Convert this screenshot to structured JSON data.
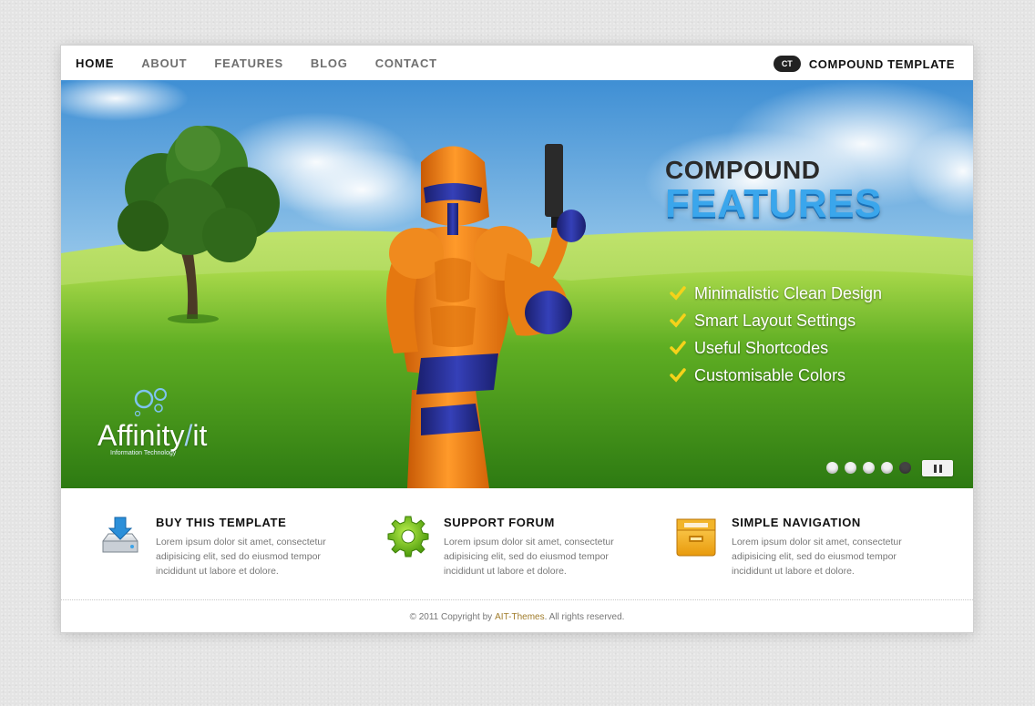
{
  "nav": {
    "items": [
      "HOME",
      "ABOUT",
      "FEATURES",
      "BLOG",
      "CONTACT"
    ],
    "active": "HOME"
  },
  "brand": {
    "logo_text": "CT",
    "name": "COMPOUND TEMPLATE"
  },
  "hero": {
    "headline_top": "COMPOUND",
    "headline_bottom": "FEATURES",
    "features": [
      "Minimalistic Clean Design",
      "Smart Layout Settings",
      "Useful Shortcodes",
      "Customisable Colors"
    ],
    "logo_main": "Affinity",
    "logo_slash": "/",
    "logo_suffix": "it",
    "logo_sub": "Information Technology",
    "slider": {
      "count": 5,
      "active": 5
    }
  },
  "boxes": [
    {
      "title": "BUY THIS TEMPLATE",
      "text": "Lorem ipsum dolor sit amet, consectetur adipisicing elit, sed do eiusmod tempor incididunt ut labore et dolore.",
      "icon": "download-drive-icon"
    },
    {
      "title": "SUPPORT FORUM",
      "text": "Lorem ipsum dolor sit amet, consectetur adipisicing elit, sed do eiusmod tempor incididunt ut labore et dolore.",
      "icon": "gear-icon"
    },
    {
      "title": "SIMPLE NAVIGATION",
      "text": "Lorem ipsum dolor sit amet, consectetur adipisicing elit, sed do eiusmod tempor incididunt ut labore et dolore.",
      "icon": "folder-box-icon"
    }
  ],
  "footer": {
    "prefix": "© 2011 Copyright by",
    "link": "AIT-Themes",
    "suffix": ". All rights reserved."
  },
  "colors": {
    "accent_blue": "#3aa6ec",
    "robot_orange": "#f07c12",
    "link_gold": "#a07c2a"
  }
}
